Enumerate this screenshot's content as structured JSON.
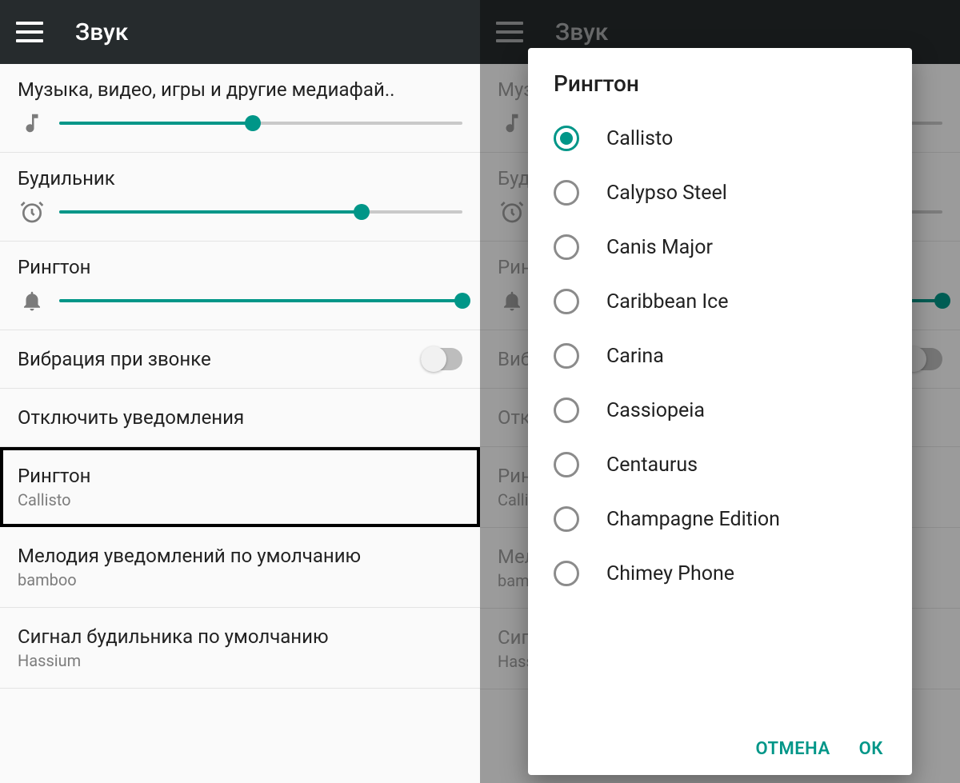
{
  "appbar": {
    "title": "Звук"
  },
  "sliders": {
    "media": {
      "label": "Музыка, видео, игры и другие медиафай..",
      "percent": 48
    },
    "alarm": {
      "label": "Будильник",
      "percent": 75
    },
    "ringtone": {
      "label": "Рингтон",
      "percent": 100
    }
  },
  "settings": {
    "vibrate": {
      "title": "Вибрация при звонке"
    },
    "dnd": {
      "title": "Отключить уведомления"
    },
    "ringtone": {
      "title": "Рингтон",
      "subtitle": "Callisto"
    },
    "notify": {
      "title": "Мелодия уведомлений по умолчанию",
      "subtitle": "bamboo"
    },
    "alarm": {
      "title": "Сигнал будильника по умолчанию",
      "subtitle": "Hassium"
    }
  },
  "dialog": {
    "title": "Рингтон",
    "options": [
      "Callisto",
      "Calypso Steel",
      "Canis Major",
      "Caribbean Ice",
      "Carina",
      "Cassiopeia",
      "Centaurus",
      "Champagne Edition",
      "Chimey Phone"
    ],
    "selected_index": 0,
    "cancel": "ОТМЕНА",
    "ok": "ОК"
  },
  "colors": {
    "accent": "#009688"
  }
}
